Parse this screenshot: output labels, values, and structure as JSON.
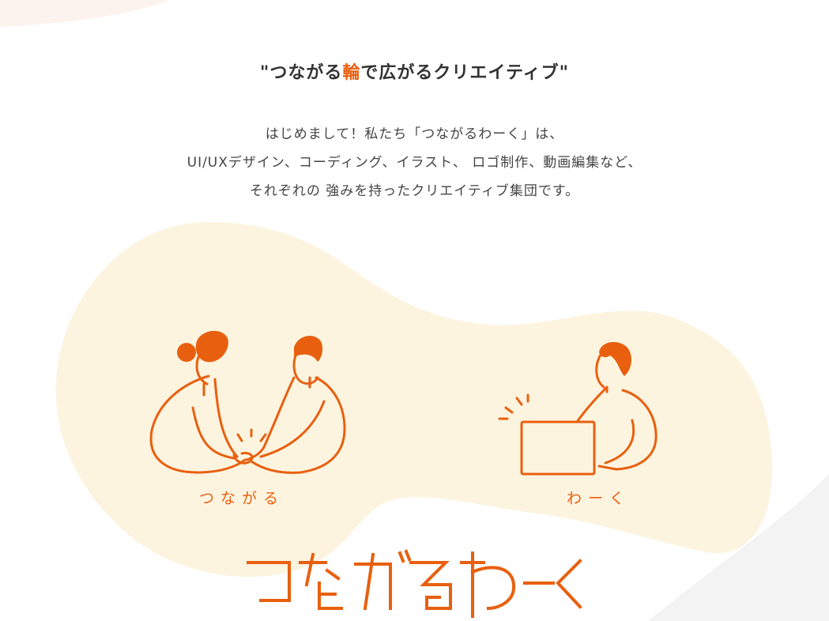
{
  "hero": {
    "headline_open": "\"つながる",
    "headline_accent": "輪",
    "headline_close": "で広がるクリエイティブ\"",
    "intro_lines": [
      "はじめまして！私たち「つながるわーく」は、",
      "UI/UXデザイン、コーディング、イラスト、 ロゴ制作、動画編集など、",
      "それぞれの 強みを持ったクリエイティブ集団です。"
    ]
  },
  "illustrations": {
    "connect_label": "つながる",
    "work_label": "わーく"
  },
  "logo": {
    "text": "つながるわーく"
  },
  "colors": {
    "accent": "#e8600f",
    "blob": "#fdf4e0",
    "text": "#333333"
  }
}
